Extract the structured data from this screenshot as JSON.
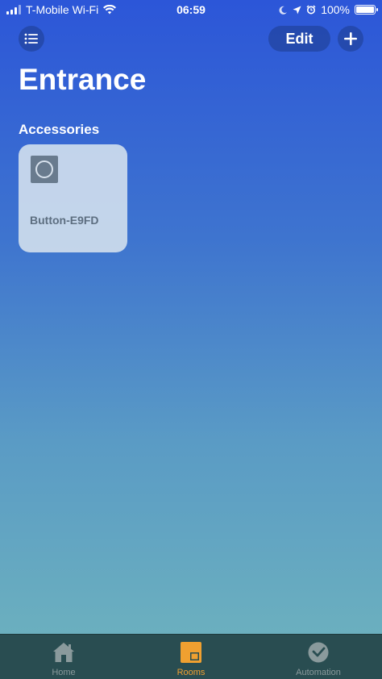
{
  "status_bar": {
    "carrier": "T-Mobile Wi-Fi",
    "time": "06:59",
    "battery": "100%",
    "battery_level": 1.0
  },
  "header": {
    "edit_label": "Edit",
    "menu_icon": "list-icon",
    "add_icon": "plus-icon"
  },
  "page": {
    "title": "Entrance",
    "section_title": "Accessories"
  },
  "accessories": [
    {
      "name": "Button-E9FD",
      "icon": "button-icon"
    }
  ],
  "tabbar": {
    "tabs": [
      {
        "label": "Home",
        "icon": "house-icon",
        "selected": false
      },
      {
        "label": "Rooms",
        "icon": "rooms-icon",
        "selected": true
      },
      {
        "label": "Automation",
        "icon": "clock-check-icon",
        "selected": false
      }
    ]
  },
  "colors": {
    "accent": "#f0a030",
    "tabbar_bg": "#294d51",
    "tile_bg": "#d6e2ee"
  }
}
